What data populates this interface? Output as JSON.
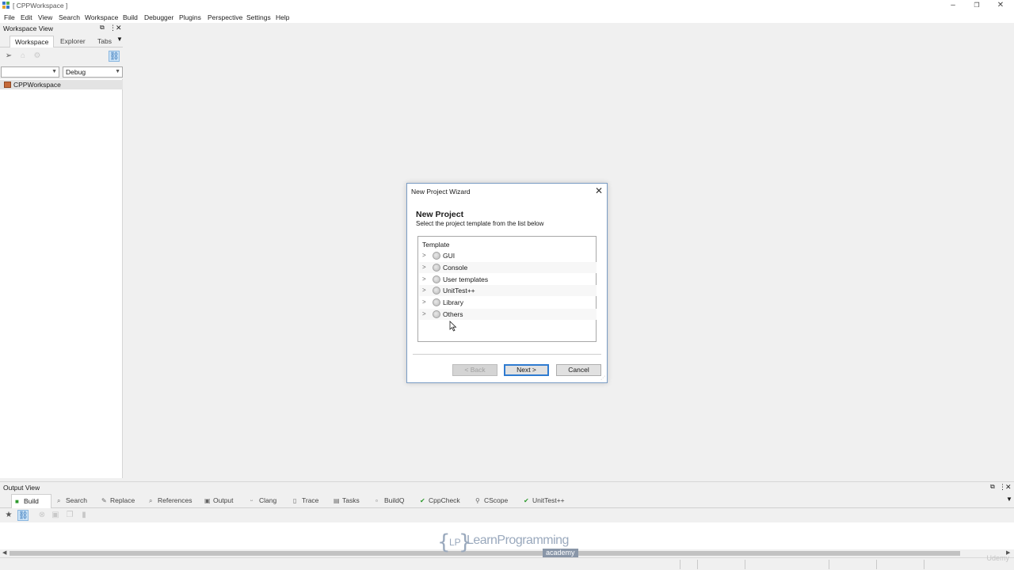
{
  "window": {
    "title": "[ CPPWorkspace ]",
    "minimize": "–",
    "restore": "❐",
    "close": "✕"
  },
  "menu": [
    "File",
    "Edit",
    "View",
    "Search",
    "Workspace",
    "Build",
    "Debugger",
    "Plugins",
    "Perspective",
    "Settings",
    "Help"
  ],
  "workspace_view": {
    "title": "Workspace View",
    "tabs": [
      "Workspace",
      "Explorer",
      "Tabs"
    ],
    "active_tab": "Workspace",
    "config_combo_left": "",
    "config_combo_right": "Debug",
    "tree": [
      {
        "label": "CPPWorkspace",
        "icon": "workspace-icon"
      }
    ]
  },
  "dialog": {
    "title": "New Project Wizard",
    "heading": "New Project",
    "subheading": "Select the project template from the list below",
    "list_header": "Template",
    "categories": [
      "GUI",
      "Console",
      "User templates",
      "UnitTest++",
      "Library",
      "Others"
    ],
    "back_label": "< Back",
    "next_label": "Next >",
    "cancel_label": "Cancel"
  },
  "output_view": {
    "title": "Output View",
    "tabs": [
      {
        "label": "Build",
        "icon": "build-icon"
      },
      {
        "label": "Search",
        "icon": "search-icon"
      },
      {
        "label": "Replace",
        "icon": "replace-icon"
      },
      {
        "label": "References",
        "icon": "references-icon"
      },
      {
        "label": "Output",
        "icon": "output-icon"
      },
      {
        "label": "Clang",
        "icon": "clang-icon"
      },
      {
        "label": "Trace",
        "icon": "trace-icon"
      },
      {
        "label": "Tasks",
        "icon": "tasks-icon"
      },
      {
        "label": "BuildQ",
        "icon": "buildq-icon"
      },
      {
        "label": "CppCheck",
        "icon": "cppcheck-icon"
      },
      {
        "label": "CScope",
        "icon": "cscope-icon"
      },
      {
        "label": "UnitTest++",
        "icon": "unittest-icon"
      }
    ],
    "active_tab": "Build"
  },
  "watermark": {
    "brand": "LearnProgramming",
    "lp": "LP",
    "sub": "academy",
    "udemy": "Udemy"
  }
}
